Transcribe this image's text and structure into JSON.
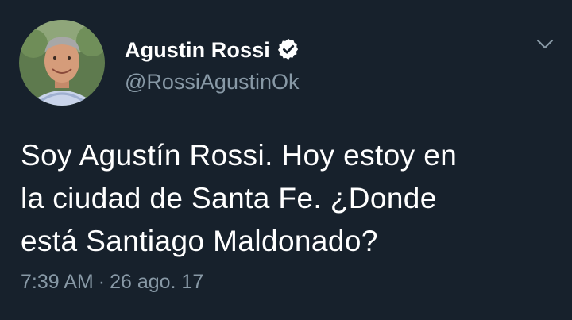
{
  "author": {
    "display_name": "Agustin Rossi",
    "handle": "@RossiAgustinOk",
    "verified": true,
    "avatar_icon": "profile-photo"
  },
  "tweet": {
    "text": "Soy Agustín Rossi. Hoy estoy en\nla ciudad de Santa Fe. ¿Donde\nestá Santiago Maldonado?",
    "time": "7:39 AM",
    "separator": "·",
    "date": "26 ago. 17"
  },
  "icons": {
    "verified": "verified-badge-icon",
    "menu": "chevron-down-icon"
  },
  "colors": {
    "background": "#17212c",
    "name": "#ffffff",
    "secondary": "#8899a6",
    "verified_badge": "#ffffff"
  }
}
